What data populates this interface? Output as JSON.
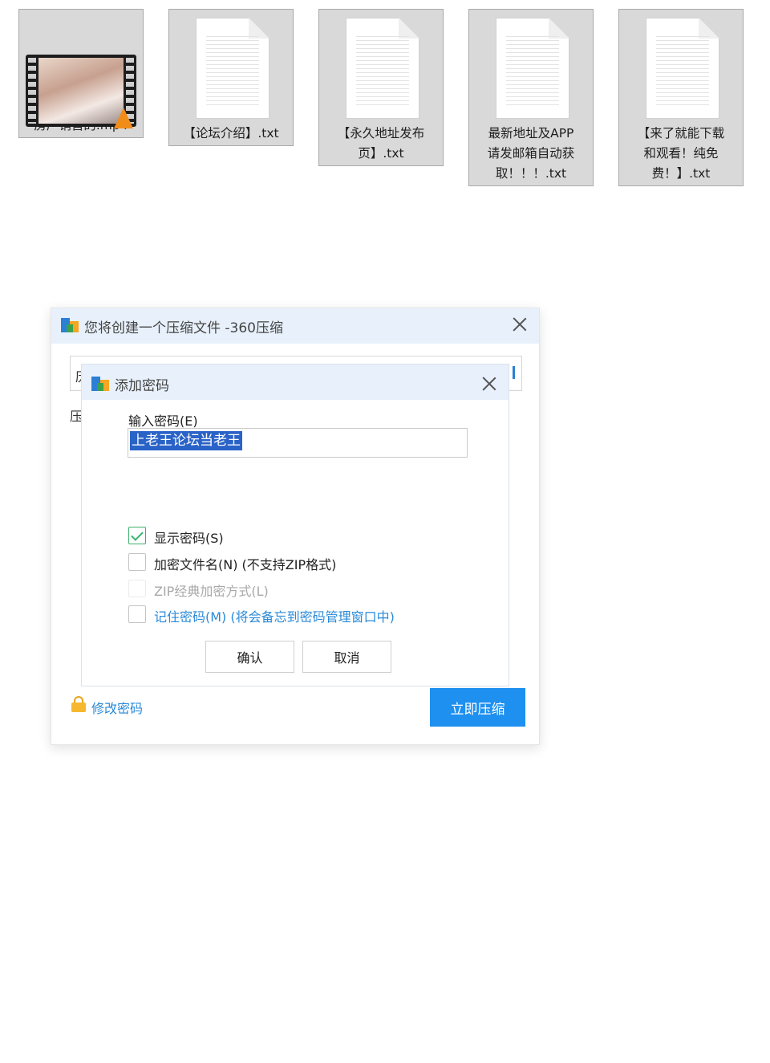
{
  "files": [
    {
      "name": "房产销售的.mp4",
      "type": "video"
    },
    {
      "name": "【论坛介绍】.txt",
      "type": "text"
    },
    {
      "name": "【永久地址发布\n页】.txt",
      "type": "text"
    },
    {
      "name": "最新地址及APP\n请发邮箱自动获\n取！！！.txt",
      "type": "text"
    },
    {
      "name": "【来了就能下载\n和观看！纯免\n费！】.txt",
      "type": "text"
    }
  ],
  "main_dialog": {
    "title": "您将创建一个压缩文件 -360压缩",
    "field_stub": "历",
    "label_stub": "压",
    "modify_password_link": "修改密码",
    "compress_button": "立即压缩"
  },
  "password_dialog": {
    "title": "添加密码",
    "input_label": "输入密码(E)",
    "password_value": "上老王论坛当老王",
    "options": [
      {
        "label": "显示密码(S)",
        "checked": true,
        "enabled": true,
        "style": "normal"
      },
      {
        "label": "加密文件名(N) (不支持ZIP格式)",
        "checked": false,
        "enabled": true,
        "style": "normal"
      },
      {
        "label": "ZIP经典加密方式(L)",
        "checked": false,
        "enabled": false,
        "style": "disabled"
      },
      {
        "label": "记住密码(M) (将会备忘到密码管理窗口中)",
        "checked": false,
        "enabled": true,
        "style": "link"
      }
    ],
    "confirm_button": "确认",
    "cancel_button": "取消"
  },
  "colors": {
    "titlebar": "#e8f1fb",
    "accent": "#1e90f0",
    "link": "#2a8ad8",
    "selection": "#2a63c7",
    "check": "#3bb26b"
  }
}
